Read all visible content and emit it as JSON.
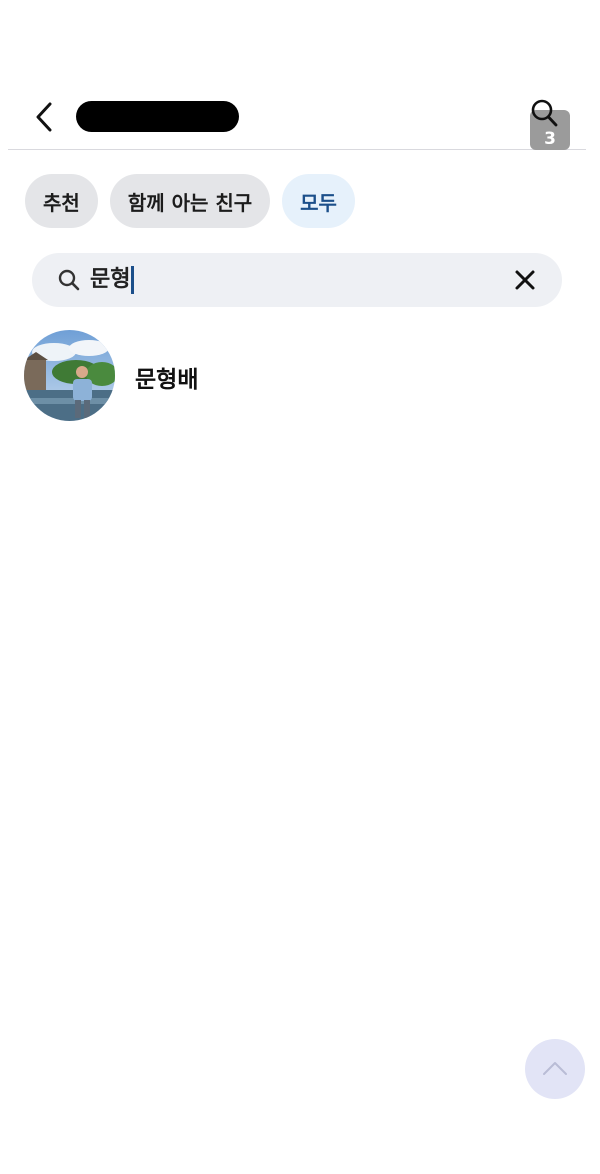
{
  "header": {
    "back_icon": "chevron-left-icon",
    "title": "",
    "search_icon": "search-icon",
    "search_badge": "3"
  },
  "tabs": [
    {
      "label": "추천",
      "active": false
    },
    {
      "label": "함께 아는 친구",
      "active": false
    },
    {
      "label": "모두",
      "active": true
    }
  ],
  "search": {
    "value": "문형",
    "clear_icon": "close-icon"
  },
  "results": [
    {
      "name": "문형배",
      "avatar": "profile-photo"
    }
  ],
  "scroll_top_icon": "chevron-up-icon",
  "colors": {
    "accent": "#1b4f8a",
    "chip_bg": "#e4e5e8",
    "chip_active_bg": "#e6f1fb",
    "search_bg": "#eef0f4",
    "scroll_top_bg": "#e2e4f6"
  }
}
